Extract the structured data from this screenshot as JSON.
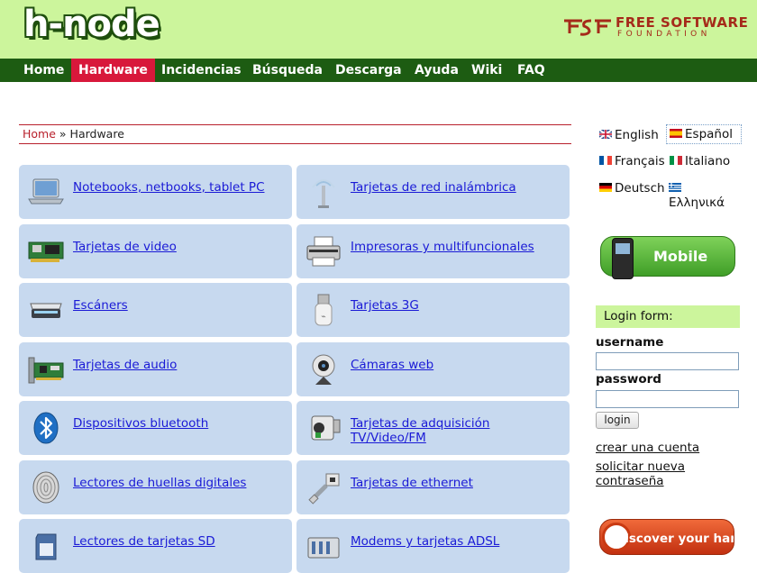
{
  "header": {
    "logo": "h-node",
    "fsf": {
      "line1": "FREE SOFTWARE",
      "line2": "FOUNDATION"
    }
  },
  "nav": {
    "items": [
      {
        "label": "Home"
      },
      {
        "label": "Hardware",
        "active": true
      },
      {
        "label": "Incidencias"
      },
      {
        "label": "Búsqueda"
      },
      {
        "label": "Descarga"
      },
      {
        "label": "Ayuda"
      },
      {
        "label": "Wiki"
      },
      {
        "label": "FAQ"
      }
    ]
  },
  "breadcrumb": {
    "home": "Home",
    "separator": "»",
    "current": "Hardware"
  },
  "categories": [
    {
      "label": "Notebooks, netbooks, tablet PC",
      "icon": "laptop-icon"
    },
    {
      "label": "Tarjetas de red inalámbrica",
      "icon": "wireless-antenna-icon"
    },
    {
      "label": "Tarjetas de video",
      "icon": "video-card-icon"
    },
    {
      "label": "Impresoras y multifuncionales",
      "icon": "printer-icon"
    },
    {
      "label": "Escáners",
      "icon": "scanner-icon"
    },
    {
      "label": "Tarjetas 3G",
      "icon": "usb-3g-modem-icon"
    },
    {
      "label": "Tarjetas de audio",
      "icon": "sound-card-icon"
    },
    {
      "label": "Cámaras web",
      "icon": "webcam-icon"
    },
    {
      "label": "Dispositivos bluetooth",
      "icon": "bluetooth-icon"
    },
    {
      "label": "Tarjetas de adquisición TV/Video/FM",
      "icon": "video-camera-icon"
    },
    {
      "label": "Lectores de huellas digitales",
      "icon": "fingerprint-icon"
    },
    {
      "label": "Tarjetas de ethernet",
      "icon": "ethernet-cable-icon"
    },
    {
      "label": "Lectores de tarjetas SD",
      "icon": "sd-card-icon"
    },
    {
      "label": "Modems y tarjetas ADSL",
      "icon": "modem-icon"
    }
  ],
  "languages": [
    {
      "label": "English",
      "flag": "uk-flag-icon"
    },
    {
      "label": "Español",
      "flag": "spain-flag-icon",
      "selected": true
    },
    {
      "label": "Français",
      "flag": "france-flag-icon"
    },
    {
      "label": "Italiano",
      "flag": "italy-flag-icon"
    },
    {
      "label": "Deutsch",
      "flag": "germany-flag-icon"
    },
    {
      "label": "Ελληνικά",
      "flag": "greece-flag-icon"
    }
  ],
  "mobile": {
    "label": "Mobile"
  },
  "login": {
    "title": "Login form:",
    "username_label": "username",
    "username_value": "",
    "password_label": "password",
    "password_value": "",
    "button": "login",
    "create_account": "crear una cuenta",
    "new_password": "solicitar nueva contraseña"
  },
  "discover": {
    "label": "Discover your hardware"
  },
  "colors": {
    "header_bg": "#ccf59c",
    "nav_bg": "#1d5c12",
    "nav_active": "#d8183b",
    "card_bg": "#c7d9ef",
    "link": "#1a1ad6",
    "fsf_red": "#a52a1a"
  }
}
